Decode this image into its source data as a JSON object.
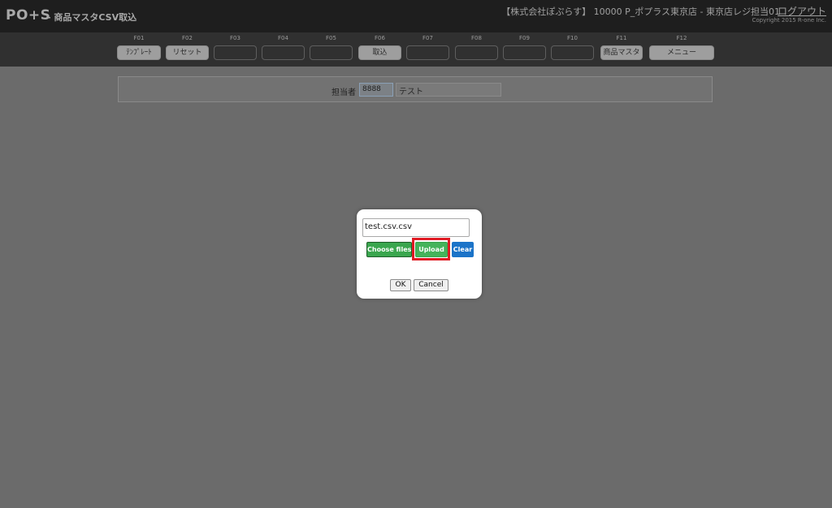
{
  "header": {
    "logo": "PO+S",
    "subtitle": "- 商品マスタCSV取込",
    "user_info": "【株式会社ぽぷらす】 10000 P_ポプラス東京店 - 東京店レジ担当01",
    "logout": "ログアウト",
    "copyright": "Copyright 2015 R-one Inc."
  },
  "fkeys": [
    {
      "code": "F01",
      "label": "ﾃﾝﾌﾟﾚｰﾄ"
    },
    {
      "code": "F02",
      "label": "リセット"
    },
    {
      "code": "F03",
      "label": ""
    },
    {
      "code": "F04",
      "label": ""
    },
    {
      "code": "F05",
      "label": ""
    },
    {
      "code": "F06",
      "label": "取込"
    },
    {
      "code": "F07",
      "label": ""
    },
    {
      "code": "F08",
      "label": ""
    },
    {
      "code": "F09",
      "label": ""
    },
    {
      "code": "F10",
      "label": ""
    },
    {
      "code": "F11",
      "label": "商品マスタ"
    },
    {
      "code": "F12",
      "label": "メニュー"
    }
  ],
  "staff": {
    "label": "担当者",
    "code": "8888",
    "name": "テスト"
  },
  "dialog": {
    "file_value": "test.csv.csv",
    "choose_label": "Choose files",
    "upload_label": "Upload",
    "clear_label": "Clear",
    "ok_label": "OK",
    "cancel_label": "Cancel"
  },
  "colors": {
    "choose": "#3aa64e",
    "upload": "#44b35a",
    "clear": "#1b73c8",
    "highlight": "#e01b24"
  }
}
